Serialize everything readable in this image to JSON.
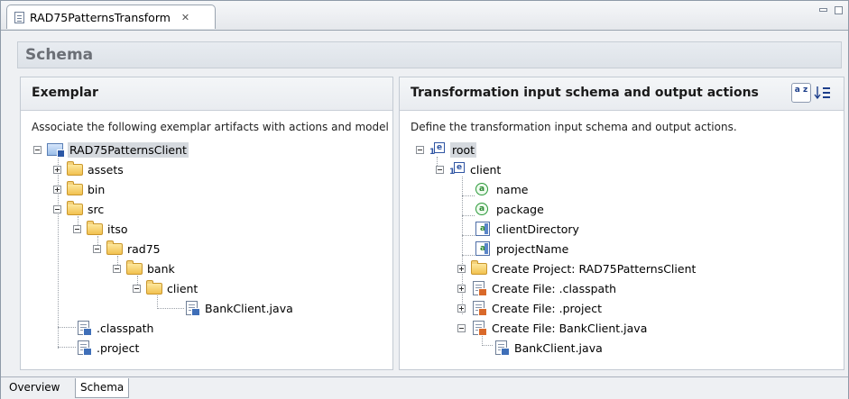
{
  "editor_tab": {
    "title": "RAD75PatternsTransform",
    "close_glyph": "✕"
  },
  "schema": {
    "title": "Schema"
  },
  "exemplar": {
    "title": "Exemplar",
    "description": "Associate the following exemplar artifacts with actions and model",
    "tree": [
      {
        "label": "RAD75PatternsClient",
        "icon": "project-icon"
      },
      {
        "label": "assets",
        "icon": "folder-icon"
      },
      {
        "label": "bin",
        "icon": "folder-icon"
      },
      {
        "label": "src",
        "icon": "folder-icon"
      },
      {
        "label": "itso",
        "icon": "folder-icon"
      },
      {
        "label": "rad75",
        "icon": "folder-icon"
      },
      {
        "label": "bank",
        "icon": "folder-icon"
      },
      {
        "label": "client",
        "icon": "folder-icon"
      },
      {
        "label": "BankClient.java",
        "icon": "java-file-icon"
      },
      {
        "label": ".classpath",
        "icon": "file-icon"
      },
      {
        "label": ".project",
        "icon": "file-icon"
      }
    ]
  },
  "transformation": {
    "title": "Transformation input schema and output actions",
    "description": "Define the transformation input schema and output actions.",
    "sort_button_glyph": "a z",
    "tree": [
      {
        "label": "root",
        "icon": "element-icon"
      },
      {
        "label": "client",
        "icon": "element-icon"
      },
      {
        "label": "name",
        "icon": "attribute-icon"
      },
      {
        "label": "package",
        "icon": "attribute-icon"
      },
      {
        "label": "clientDirectory",
        "icon": "attribute-field-icon"
      },
      {
        "label": "projectName",
        "icon": "attribute-field-icon"
      },
      {
        "label": "Create Project: RAD75PatternsClient",
        "icon": "create-project-icon"
      },
      {
        "label": "Create File: .classpath",
        "icon": "create-file-icon"
      },
      {
        "label": "Create File: .project",
        "icon": "create-file-icon"
      },
      {
        "label": "Create File: BankClient.java",
        "icon": "create-file-icon"
      },
      {
        "label": "BankClient.java",
        "icon": "java-file-icon"
      }
    ]
  },
  "page_tabs": [
    {
      "label": "Overview"
    },
    {
      "label": "Schema",
      "selected": true
    }
  ]
}
